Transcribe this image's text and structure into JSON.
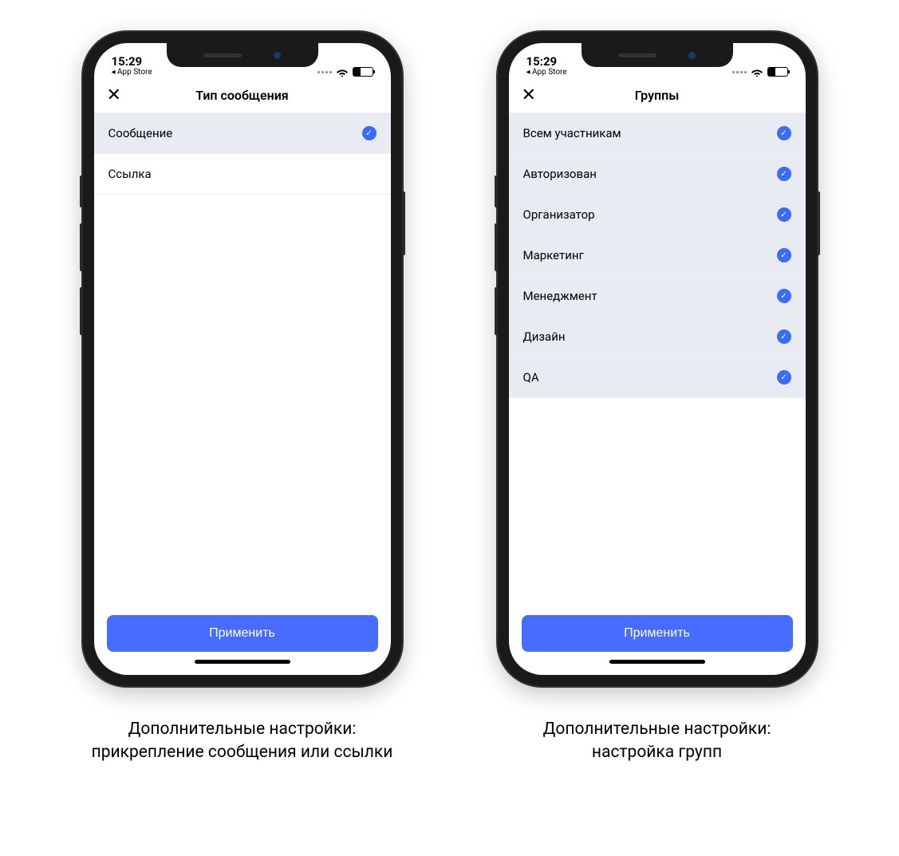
{
  "status": {
    "time": "15:29",
    "back_app": "◂ App Store"
  },
  "screens": [
    {
      "title": "Тип сообщения",
      "apply": "Применить",
      "caption": "Дополнительные настройки: прикрепление сообщения или ссылки",
      "rows": [
        {
          "label": "Сообщение",
          "selected": true
        },
        {
          "label": "Ссылка",
          "selected": false
        }
      ]
    },
    {
      "title": "Группы",
      "apply": "Применить",
      "caption": "Дополнительные настройки: настройка групп",
      "rows": [
        {
          "label": "Всем участникам",
          "selected": true
        },
        {
          "label": "Авторизован",
          "selected": true
        },
        {
          "label": "Организатор",
          "selected": true
        },
        {
          "label": "Маркетинг",
          "selected": true
        },
        {
          "label": "Менеджмент",
          "selected": true
        },
        {
          "label": "Дизайн",
          "selected": true
        },
        {
          "label": "QA",
          "selected": true
        }
      ]
    }
  ]
}
